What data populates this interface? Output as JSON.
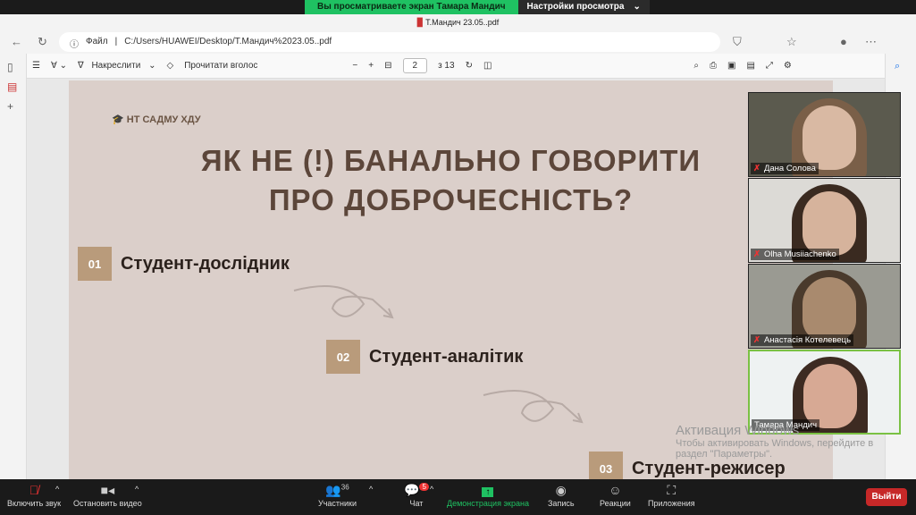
{
  "zoom_banner": {
    "viewing": "Вы просматриваете экран Тамара Мандич",
    "settings": "Настройки просмотра"
  },
  "browser": {
    "tab_title": "Т.Мандич 23.05..pdf",
    "file_label": "Файл",
    "url": "C:/Users/HUAWEI/Desktop/Т.Мандич%2023.05..pdf"
  },
  "pdf_toolbar": {
    "draw": "Накреслити",
    "read_aloud": "Прочитати вголос",
    "page": "2",
    "of_pages": "з 13"
  },
  "slide": {
    "brand": "НТ САДМУ ХДУ",
    "title_line1": "ЯК НЕ (!) БАНАЛЬНО ГОВОРИТИ",
    "title_line2": "ПРО ДОБРОЧЕСНІСТЬ?",
    "items": [
      {
        "num": "01",
        "label": "Студент-дослідник"
      },
      {
        "num": "02",
        "label": "Студент-аналітик"
      },
      {
        "num": "03",
        "label": "Студент-режисер"
      }
    ]
  },
  "participants": [
    {
      "name": "Дана Солова"
    },
    {
      "name": "Olha Musiiachenko"
    },
    {
      "name": "Анастасія Котелевець"
    },
    {
      "name": "Тамара Мандич"
    }
  ],
  "windows_activation": {
    "title": "Активация Windows",
    "text1": "Чтобы активировать Windows, перейдите в",
    "text2": "раздел \"Параметры\"."
  },
  "zoom_bar": {
    "mute": "Включить звук",
    "video": "Остановить видео",
    "participants": "Участники",
    "participants_count": "36",
    "chat": "Чат",
    "chat_badge": "5",
    "share": "Демонстрация экрана",
    "record": "Запись",
    "reactions": "Реакции",
    "apps": "Приложения",
    "leave": "Выйти"
  }
}
